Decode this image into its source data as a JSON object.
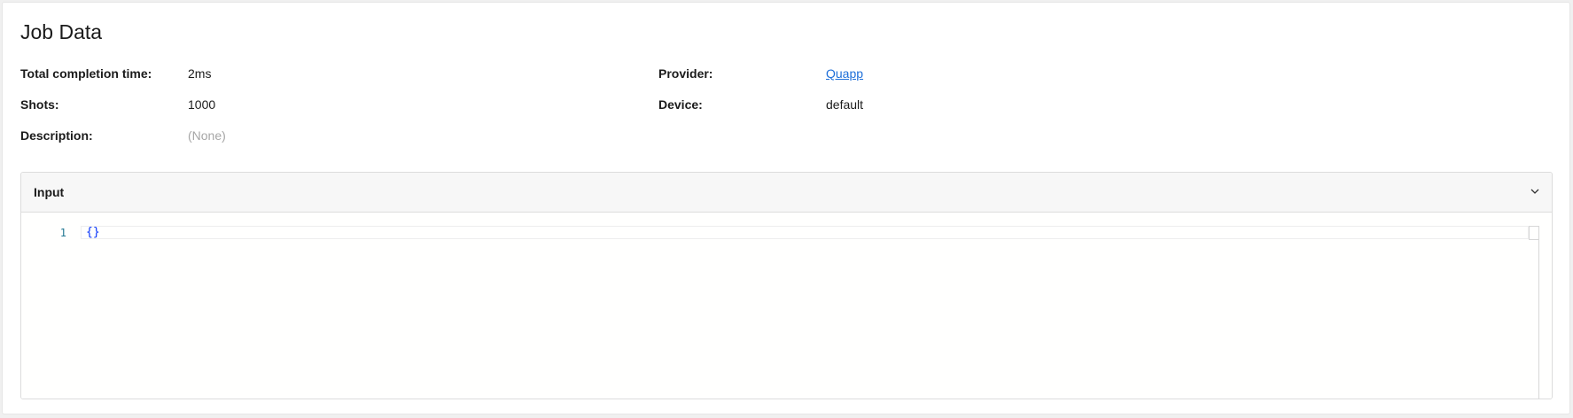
{
  "job_data": {
    "title": "Job Data",
    "fields": {
      "total_completion_time": {
        "label": "Total completion time:",
        "value": "2ms"
      },
      "shots": {
        "label": "Shots:",
        "value": "1000"
      },
      "description": {
        "label": "Description:",
        "value": "(None)"
      },
      "provider": {
        "label": "Provider:",
        "value": "Quapp"
      },
      "device": {
        "label": "Device:",
        "value": "default"
      }
    }
  },
  "input_panel": {
    "title": "Input",
    "expand_icon": "chevron-down-icon",
    "editor": {
      "line_number": "1",
      "content": "{}"
    }
  },
  "colors": {
    "link": "#1e6fd9",
    "muted": "#a6a6a6",
    "code": "#0431fa",
    "line_number": "#237893"
  }
}
